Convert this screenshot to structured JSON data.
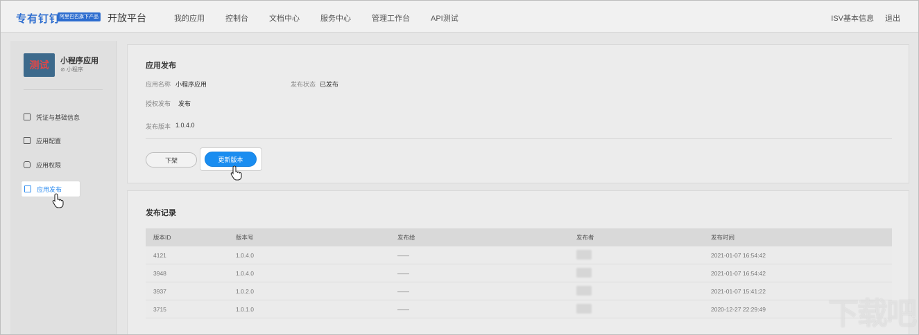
{
  "header": {
    "logo_text": "专有钉钉",
    "logo_tag": "阿里巴巴旗下产品",
    "platform_title": "开放平台",
    "nav": [
      "我的应用",
      "控制台",
      "文档中心",
      "服务中心",
      "管理工作台",
      "API测试"
    ],
    "right_links": [
      "ISV基本信息",
      "退出"
    ]
  },
  "sidebar": {
    "app_icon_text": "测试",
    "app_name": "小程序应用",
    "app_type": "⊘ 小程序",
    "items": [
      {
        "label": "凭证与基础信息",
        "icon": "document-icon"
      },
      {
        "label": "应用配置",
        "icon": "config-icon"
      },
      {
        "label": "应用权限",
        "icon": "lock-icon"
      },
      {
        "label": "应用发布",
        "icon": "publish-icon",
        "active": true
      }
    ]
  },
  "publish": {
    "title": "应用发布",
    "app_name_label": "应用名称",
    "app_name_value": "小程序应用",
    "status_label": "发布状态",
    "status_value": "已发布",
    "auth_label": "授权发布",
    "auth_value": "发布",
    "version_label": "发布版本",
    "version_value": "1.0.4.0",
    "btn_off_label": "下架",
    "btn_update_label": "更新版本"
  },
  "records": {
    "title": "发布记录",
    "columns": [
      "版本ID",
      "版本号",
      "发布给",
      "发布者",
      "发布时间"
    ],
    "rows": [
      {
        "id": "4121",
        "version": "1.0.4.0",
        "target": "——",
        "time": "2021-01-07 16:54:42"
      },
      {
        "id": "3948",
        "version": "1.0.4.0",
        "target": "——",
        "time": "2021-01-07 16:54:42"
      },
      {
        "id": "3937",
        "version": "1.0.2.0",
        "target": "——",
        "time": "2021-01-07 15:41:22"
      },
      {
        "id": "3715",
        "version": "1.0.1.0",
        "target": "——",
        "time": "2020-12-27 22:29:49"
      }
    ]
  },
  "watermark": "下载吧",
  "colors": {
    "accent": "#1a8df0",
    "brand": "#2d6dcf"
  }
}
